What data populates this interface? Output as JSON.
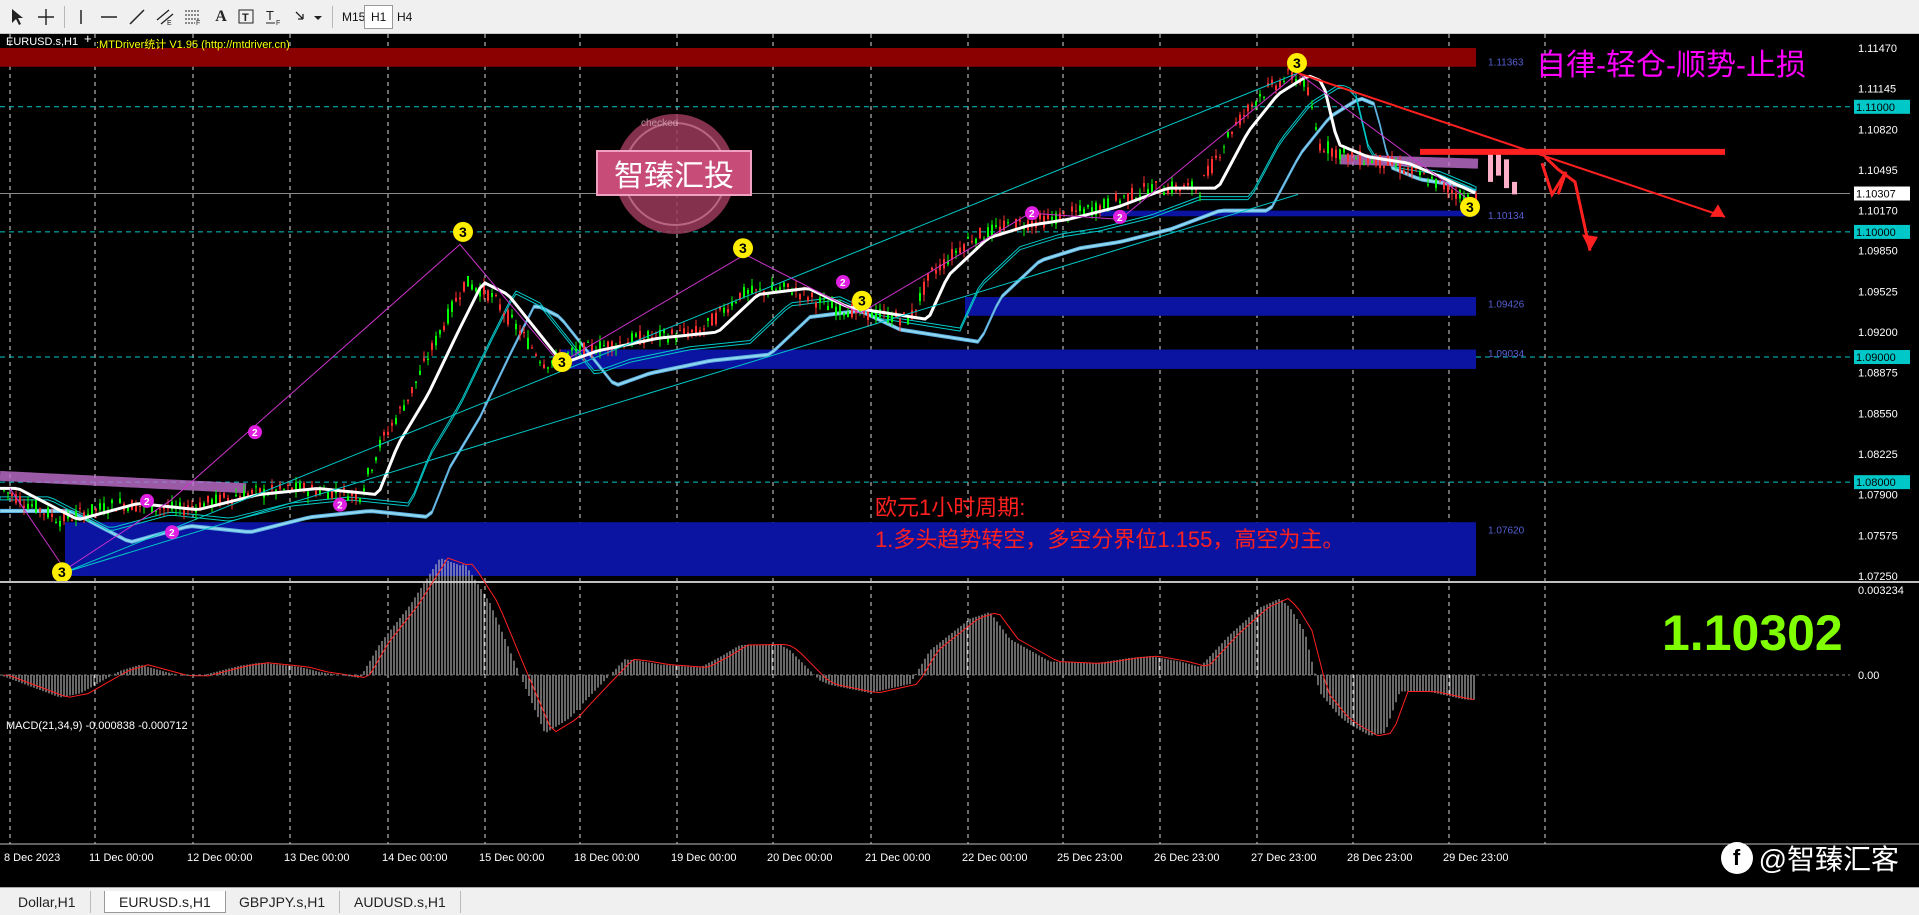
{
  "toolbar": {
    "tools": [
      {
        "name": "cursor-icon"
      },
      {
        "name": "crosshair-icon"
      },
      {
        "name": "vertical-line-icon"
      },
      {
        "name": "horizontal-line-icon"
      },
      {
        "name": "trendline-icon"
      },
      {
        "name": "equidistant-channel-icon"
      },
      {
        "name": "fibonacci-icon"
      },
      {
        "name": "text-icon"
      },
      {
        "name": "text-label-icon"
      },
      {
        "name": "arrows-icon"
      }
    ],
    "timeframes": [
      "M15",
      "H1",
      "H4"
    ],
    "active_timeframe": "H1"
  },
  "chart": {
    "symbol_label": "EURUSD.s,H1",
    "indicator_label": ":MTDriver统计  V1.95 (http://mtdriver.cn)",
    "slogan": "自律-轻仓-顺势-止损",
    "stamp_text": "智臻汇投",
    "stamp_ring_text": "checked",
    "analysis_line1": "欧元1小时周期:",
    "analysis_line2": "1.多头趋势转空，多空分界位1.155，高空为主。",
    "current_price_big": "1.10302",
    "macd_label": "MACD(21,34,9) -0.000838 -0.000712",
    "price_axis": [
      "1.11470",
      "1.11145",
      "1.10820",
      "1.10495",
      "1.10170",
      "1.09850",
      "1.09525",
      "1.09200",
      "1.08875",
      "1.08550",
      "1.08225",
      "1.07900",
      "1.07575",
      "1.07250"
    ],
    "highlight_prices": [
      "1.11000",
      "1.10307",
      "1.10000",
      "1.09000",
      "1.08000"
    ],
    "zone_labels": [
      "1.11363",
      "1.10134",
      "1.09426",
      "1.09034",
      "1.07620"
    ],
    "macd_axis": [
      "0.003234",
      "0.00"
    ],
    "time_axis": [
      "8 Dec 2023",
      "11 Dec 00:00",
      "12 Dec 00:00",
      "13 Dec 00:00",
      "14 Dec 00:00",
      "15 Dec 00:00",
      "18 Dec 00:00",
      "19 Dec 00:00",
      "20 Dec 00:00",
      "21 Dec 00:00",
      "22 Dec 00:00",
      "25 Dec 23:00",
      "26 Dec 23:00",
      "27 Dec 23:00",
      "28 Dec 23:00",
      "29 Dec 23:00"
    ],
    "wave_markers": [
      "3",
      "3",
      "3",
      "3",
      "3",
      "3",
      "3",
      "2",
      "2",
      "2",
      "2",
      "2",
      "2",
      "2"
    ],
    "colors": {
      "bull_candle": "#00ff00",
      "bear_candle": "#ff3030",
      "zone_blue": "#0a14a0",
      "zone_red": "#8b0000",
      "slogan": "#ff00ff",
      "analysis_text": "#ff2020",
      "big_price": "#7fff00",
      "grid": "#ffffff",
      "cyan_line": "#00c8c8"
    }
  },
  "tabs": [
    {
      "label": "Dollar,H1"
    },
    {
      "label": "EURUSD.s,H1"
    },
    {
      "label": "GBPJPY.s,H1"
    },
    {
      "label": "AUDUSD.s,H1"
    }
  ],
  "active_tab": "EURUSD.s,H1",
  "watermark": "@智臻汇客"
}
